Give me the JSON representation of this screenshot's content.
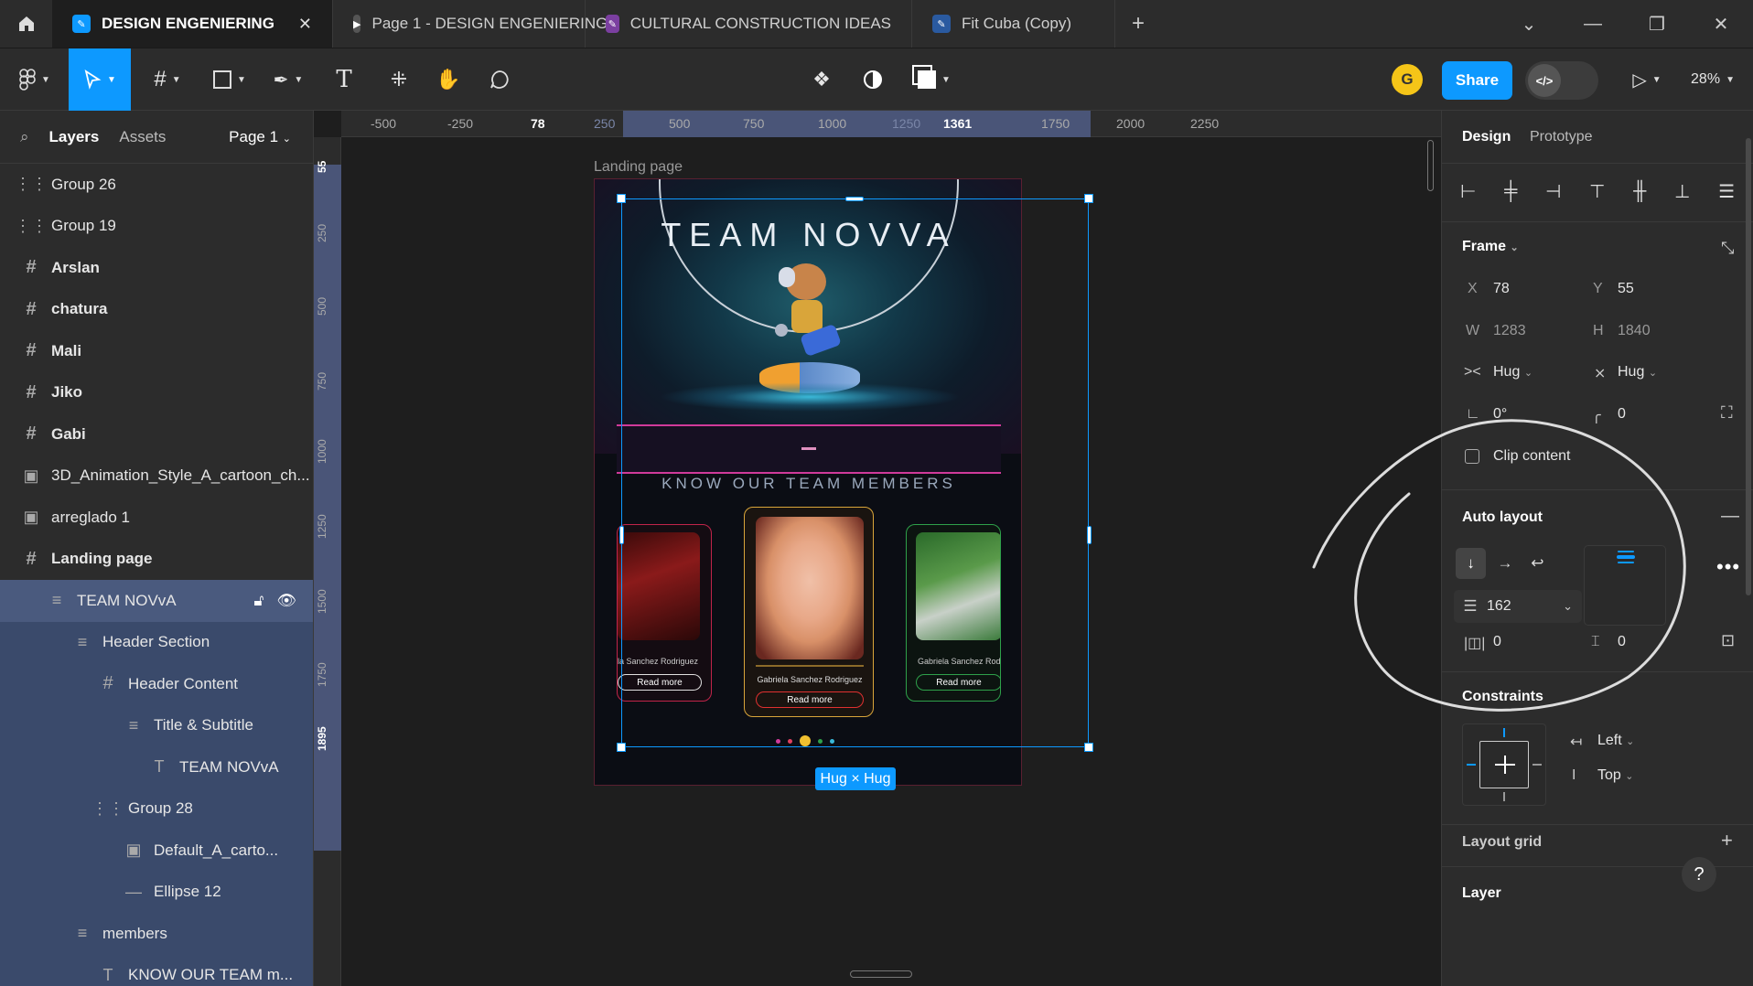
{
  "tabs": [
    {
      "label": "DESIGN ENGENIERING",
      "active": true,
      "icon": "figma-file-icon",
      "color": "#0d99ff"
    },
    {
      "label": "Page 1 - DESIGN ENGENIERING",
      "active": false,
      "icon": "play-prototype-icon",
      "color": "#555555"
    },
    {
      "label": "CULTURAL CONSTRUCTION IDEAS",
      "active": false,
      "icon": "figjam-file-icon",
      "color": "#7b3fa0"
    },
    {
      "label": "Fit Cuba (Copy)",
      "active": false,
      "icon": "figma-file-icon",
      "color": "#2a5aa0"
    }
  ],
  "toolbar": {
    "share_label": "Share",
    "avatar_initial": "G",
    "zoom_label": "28%"
  },
  "left_panel": {
    "tab_layers": "Layers",
    "tab_assets": "Assets",
    "page_selector": "Page 1",
    "layers": [
      {
        "label": "Group 26",
        "icon": "group-icon",
        "bold": false,
        "indent": 0
      },
      {
        "label": "Group 19",
        "icon": "group-icon",
        "bold": false,
        "indent": 0
      },
      {
        "label": "Arslan",
        "icon": "frame-icon",
        "bold": true,
        "indent": 0
      },
      {
        "label": "chatura",
        "icon": "frame-icon",
        "bold": true,
        "indent": 0
      },
      {
        "label": "Mali",
        "icon": "frame-icon",
        "bold": true,
        "indent": 0
      },
      {
        "label": "Jiko",
        "icon": "frame-icon",
        "bold": true,
        "indent": 0
      },
      {
        "label": "Gabi",
        "icon": "frame-icon",
        "bold": true,
        "indent": 0
      },
      {
        "label": "3D_Animation_Style_A_cartoon_ch...",
        "icon": "image-icon",
        "bold": false,
        "indent": 0
      },
      {
        "label": "arreglado 1",
        "icon": "image-icon",
        "bold": false,
        "indent": 0
      },
      {
        "label": "Landing page",
        "icon": "frame-icon",
        "bold": true,
        "indent": 0
      },
      {
        "label": "TEAM NOVvA",
        "icon": "auto-layout-icon",
        "bold": false,
        "indent": 1,
        "selected": true
      },
      {
        "label": "Header Section",
        "icon": "auto-layout-icon",
        "bold": false,
        "indent": 2
      },
      {
        "label": "Header Content",
        "icon": "frame-icon",
        "bold": false,
        "indent": 3
      },
      {
        "label": "Title & Subtitle",
        "icon": "auto-layout-icon",
        "bold": false,
        "indent": 4
      },
      {
        "label": "TEAM NOVvA",
        "icon": "text-icon",
        "bold": false,
        "indent": 5
      },
      {
        "label": "Group 28",
        "icon": "group-icon",
        "bold": false,
        "indent": 3
      },
      {
        "label": "Default_A_carto...",
        "icon": "image-icon",
        "bold": false,
        "indent": 4
      },
      {
        "label": "Ellipse 12",
        "icon": "line-icon",
        "bold": false,
        "indent": 4
      },
      {
        "label": "members",
        "icon": "auto-layout-icon",
        "bold": false,
        "indent": 2
      },
      {
        "label": "KNOW OUR TEAM m...",
        "icon": "text-icon",
        "bold": false,
        "indent": 3
      }
    ]
  },
  "ruler": {
    "h_labels": [
      "-500",
      "-250",
      "78",
      "250",
      "500",
      "750",
      "1000",
      "1250",
      "1361",
      "1750",
      "2000",
      "2250"
    ],
    "v_labels": [
      "55",
      "250",
      "500",
      "750",
      "1000",
      "1250",
      "1500",
      "1750",
      "1895"
    ]
  },
  "canvas": {
    "frame_label": "Landing page",
    "hero_title": "TEAM NOVVA",
    "section_title": "KNOW OUR TEAM MEMBERS",
    "size_badge": "Hug × Hug",
    "members": [
      {
        "name": "la Sanchez Rodriguez",
        "button": "Read more",
        "accent": "#c0244a"
      },
      {
        "name": "Gabriela Sanchez Rodriguez",
        "button": "Read more",
        "accent": "#d9a53a"
      },
      {
        "name": "Gabriela Sanchez Rodr",
        "button": "Read more",
        "accent": "#2ea04a"
      }
    ]
  },
  "right_panel": {
    "tab_design": "Design",
    "tab_prototype": "Prototype",
    "frame_label": "Frame",
    "x_label": "X",
    "x_value": "78",
    "y_label": "Y",
    "y_value": "55",
    "w_label": "W",
    "w_value": "1283",
    "h_label": "H",
    "h_value": "1840",
    "hug_w": "Hug",
    "hug_h": "Hug",
    "rotation": "0°",
    "radius": "0",
    "clip_content": "Clip content",
    "auto_layout": "Auto layout",
    "gap_value": "162",
    "padding_h": "0",
    "padding_v": "0",
    "constraints": "Constraints",
    "constraint_h": "Left",
    "constraint_v": "Top",
    "layout_grid": "Layout grid",
    "layer": "Layer",
    "help": "?"
  }
}
